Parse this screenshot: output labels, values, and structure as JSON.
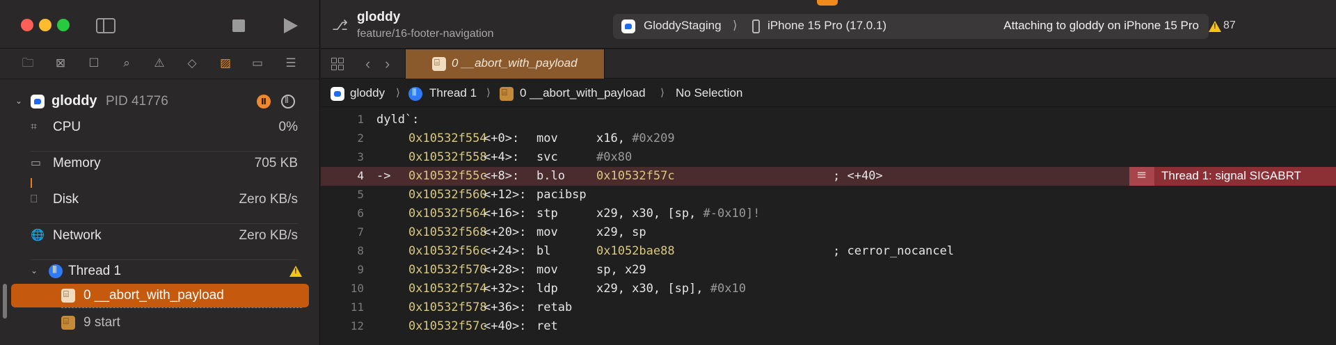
{
  "process": {
    "name": "gloddy",
    "pid": "PID 41776"
  },
  "gauges": [
    {
      "label": "CPU",
      "value": "0%"
    },
    {
      "label": "Memory",
      "value": "705 KB"
    },
    {
      "label": "Disk",
      "value": "Zero KB/s"
    },
    {
      "label": "Network",
      "value": "Zero KB/s"
    }
  ],
  "thread": {
    "label": "Thread 1"
  },
  "frames": [
    {
      "label": "0 __abort_with_payload"
    },
    {
      "label": "9 start"
    }
  ],
  "toolbar": {
    "project": "gloddy",
    "branch": "feature/16-footer-navigation",
    "scheme": "GloddyStaging",
    "device": "iPhone 15 Pro (17.0.1)",
    "status": "Attaching to gloddy on iPhone 15 Pro",
    "warnings": "87"
  },
  "tab": {
    "label": "0 __abort_with_payload"
  },
  "jumpbar": {
    "app": "gloddy",
    "thread": "Thread 1",
    "frame": "0 __abort_with_payload",
    "selection": "No Selection"
  },
  "code": {
    "header": "dyld`:",
    "current_line": 4,
    "error": "Thread 1: signal SIGABRT",
    "lines": [
      {
        "n": "2",
        "addr": "0x10532f554",
        "off": "<+0>:",
        "mnem": "mov",
        "ops": "x16, ",
        "imm": "#0x209",
        "target": "",
        "cmt": ""
      },
      {
        "n": "3",
        "addr": "0x10532f558",
        "off": "<+4>:",
        "mnem": "svc",
        "ops": "",
        "imm": "#0x80",
        "target": "",
        "cmt": ""
      },
      {
        "n": "4",
        "addr": "0x10532f55c",
        "off": "<+8>:",
        "mnem": "b.lo",
        "ops": "",
        "imm": "",
        "target": "0x10532f57c",
        "cmt": "; <+40>"
      },
      {
        "n": "5",
        "addr": "0x10532f560",
        "off": "<+12>:",
        "mnem": "pacibsp",
        "ops": "",
        "imm": "",
        "target": "",
        "cmt": ""
      },
      {
        "n": "6",
        "addr": "0x10532f564",
        "off": "<+16>:",
        "mnem": "stp",
        "ops": "x29, x30, [sp, ",
        "imm": "#-0x10]!",
        "target": "",
        "cmt": ""
      },
      {
        "n": "7",
        "addr": "0x10532f568",
        "off": "<+20>:",
        "mnem": "mov",
        "ops": "x29, sp",
        "imm": "",
        "target": "",
        "cmt": ""
      },
      {
        "n": "8",
        "addr": "0x10532f56c",
        "off": "<+24>:",
        "mnem": "bl",
        "ops": "",
        "imm": "",
        "target": "0x1052bae88",
        "cmt": "; cerror_nocancel"
      },
      {
        "n": "9",
        "addr": "0x10532f570",
        "off": "<+28>:",
        "mnem": "mov",
        "ops": "sp, x29",
        "imm": "",
        "target": "",
        "cmt": ""
      },
      {
        "n": "10",
        "addr": "0x10532f574",
        "off": "<+32>:",
        "mnem": "ldp",
        "ops": "x29, x30, [sp], ",
        "imm": "#0x10",
        "target": "",
        "cmt": ""
      },
      {
        "n": "11",
        "addr": "0x10532f578",
        "off": "<+36>:",
        "mnem": "retab",
        "ops": "",
        "imm": "",
        "target": "",
        "cmt": ""
      },
      {
        "n": "12",
        "addr": "0x10532f57c",
        "off": "<+40>:",
        "mnem": "ret",
        "ops": "",
        "imm": "",
        "target": "",
        "cmt": ""
      }
    ]
  },
  "colors": {
    "accent_orange": "#c55a0e",
    "error_red": "#8c3036",
    "address_yellow": "#d9c97c"
  }
}
